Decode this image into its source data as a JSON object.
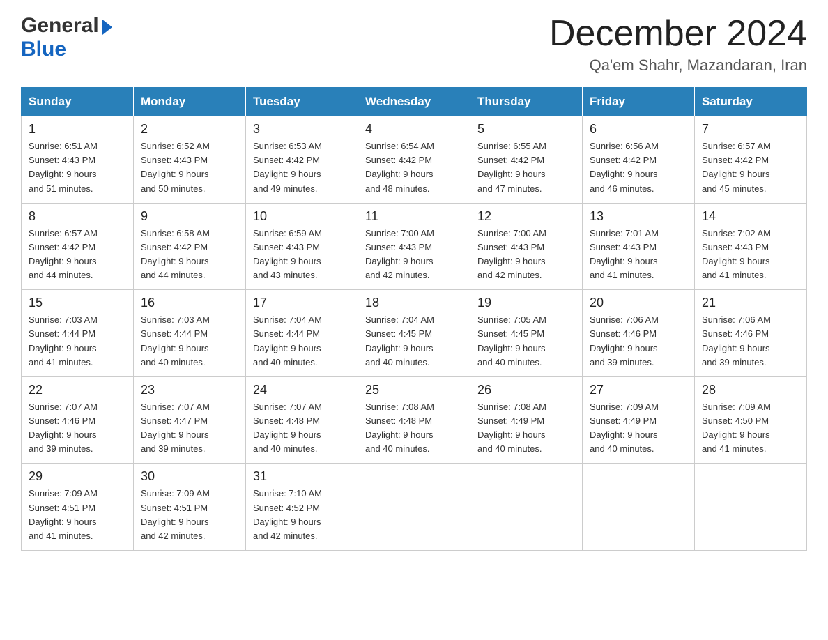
{
  "header": {
    "logo_general": "General",
    "logo_blue": "Blue",
    "month_title": "December 2024",
    "location": "Qa'em Shahr, Mazandaran, Iran"
  },
  "weekdays": [
    "Sunday",
    "Monday",
    "Tuesday",
    "Wednesday",
    "Thursday",
    "Friday",
    "Saturday"
  ],
  "weeks": [
    [
      {
        "day": "1",
        "sunrise": "6:51 AM",
        "sunset": "4:43 PM",
        "daylight": "9 hours and 51 minutes."
      },
      {
        "day": "2",
        "sunrise": "6:52 AM",
        "sunset": "4:43 PM",
        "daylight": "9 hours and 50 minutes."
      },
      {
        "day": "3",
        "sunrise": "6:53 AM",
        "sunset": "4:42 PM",
        "daylight": "9 hours and 49 minutes."
      },
      {
        "day": "4",
        "sunrise": "6:54 AM",
        "sunset": "4:42 PM",
        "daylight": "9 hours and 48 minutes."
      },
      {
        "day": "5",
        "sunrise": "6:55 AM",
        "sunset": "4:42 PM",
        "daylight": "9 hours and 47 minutes."
      },
      {
        "day": "6",
        "sunrise": "6:56 AM",
        "sunset": "4:42 PM",
        "daylight": "9 hours and 46 minutes."
      },
      {
        "day": "7",
        "sunrise": "6:57 AM",
        "sunset": "4:42 PM",
        "daylight": "9 hours and 45 minutes."
      }
    ],
    [
      {
        "day": "8",
        "sunrise": "6:57 AM",
        "sunset": "4:42 PM",
        "daylight": "9 hours and 44 minutes."
      },
      {
        "day": "9",
        "sunrise": "6:58 AM",
        "sunset": "4:42 PM",
        "daylight": "9 hours and 44 minutes."
      },
      {
        "day": "10",
        "sunrise": "6:59 AM",
        "sunset": "4:43 PM",
        "daylight": "9 hours and 43 minutes."
      },
      {
        "day": "11",
        "sunrise": "7:00 AM",
        "sunset": "4:43 PM",
        "daylight": "9 hours and 42 minutes."
      },
      {
        "day": "12",
        "sunrise": "7:00 AM",
        "sunset": "4:43 PM",
        "daylight": "9 hours and 42 minutes."
      },
      {
        "day": "13",
        "sunrise": "7:01 AM",
        "sunset": "4:43 PM",
        "daylight": "9 hours and 41 minutes."
      },
      {
        "day": "14",
        "sunrise": "7:02 AM",
        "sunset": "4:43 PM",
        "daylight": "9 hours and 41 minutes."
      }
    ],
    [
      {
        "day": "15",
        "sunrise": "7:03 AM",
        "sunset": "4:44 PM",
        "daylight": "9 hours and 41 minutes."
      },
      {
        "day": "16",
        "sunrise": "7:03 AM",
        "sunset": "4:44 PM",
        "daylight": "9 hours and 40 minutes."
      },
      {
        "day": "17",
        "sunrise": "7:04 AM",
        "sunset": "4:44 PM",
        "daylight": "9 hours and 40 minutes."
      },
      {
        "day": "18",
        "sunrise": "7:04 AM",
        "sunset": "4:45 PM",
        "daylight": "9 hours and 40 minutes."
      },
      {
        "day": "19",
        "sunrise": "7:05 AM",
        "sunset": "4:45 PM",
        "daylight": "9 hours and 40 minutes."
      },
      {
        "day": "20",
        "sunrise": "7:06 AM",
        "sunset": "4:46 PM",
        "daylight": "9 hours and 39 minutes."
      },
      {
        "day": "21",
        "sunrise": "7:06 AM",
        "sunset": "4:46 PM",
        "daylight": "9 hours and 39 minutes."
      }
    ],
    [
      {
        "day": "22",
        "sunrise": "7:07 AM",
        "sunset": "4:46 PM",
        "daylight": "9 hours and 39 minutes."
      },
      {
        "day": "23",
        "sunrise": "7:07 AM",
        "sunset": "4:47 PM",
        "daylight": "9 hours and 39 minutes."
      },
      {
        "day": "24",
        "sunrise": "7:07 AM",
        "sunset": "4:48 PM",
        "daylight": "9 hours and 40 minutes."
      },
      {
        "day": "25",
        "sunrise": "7:08 AM",
        "sunset": "4:48 PM",
        "daylight": "9 hours and 40 minutes."
      },
      {
        "day": "26",
        "sunrise": "7:08 AM",
        "sunset": "4:49 PM",
        "daylight": "9 hours and 40 minutes."
      },
      {
        "day": "27",
        "sunrise": "7:09 AM",
        "sunset": "4:49 PM",
        "daylight": "9 hours and 40 minutes."
      },
      {
        "day": "28",
        "sunrise": "7:09 AM",
        "sunset": "4:50 PM",
        "daylight": "9 hours and 41 minutes."
      }
    ],
    [
      {
        "day": "29",
        "sunrise": "7:09 AM",
        "sunset": "4:51 PM",
        "daylight": "9 hours and 41 minutes."
      },
      {
        "day": "30",
        "sunrise": "7:09 AM",
        "sunset": "4:51 PM",
        "daylight": "9 hours and 42 minutes."
      },
      {
        "day": "31",
        "sunrise": "7:10 AM",
        "sunset": "4:52 PM",
        "daylight": "9 hours and 42 minutes."
      },
      null,
      null,
      null,
      null
    ]
  ]
}
